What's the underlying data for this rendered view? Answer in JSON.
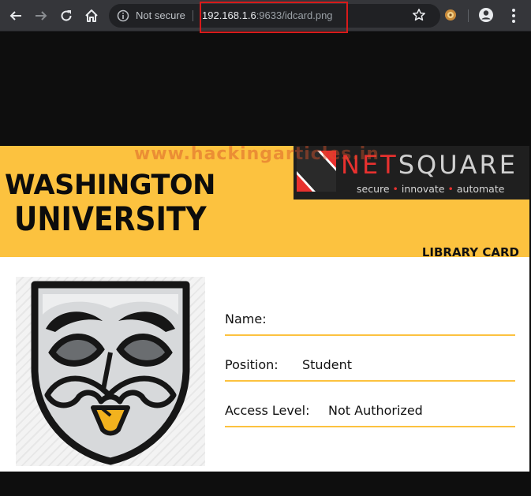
{
  "browser": {
    "security_label": "Not secure",
    "url_host": "192.168.1.6",
    "url_rest": ":9633/idcard.png",
    "icons": [
      "back-arrow-icon",
      "forward-arrow-icon",
      "reload-icon",
      "home-icon",
      "info-icon",
      "star-icon",
      "extension-icon",
      "account-icon",
      "menu-dots-icon"
    ],
    "highlight_color": "#d81a1a"
  },
  "card": {
    "university_line1": "WASHINGTON",
    "university_line2": "UNIVERSITY",
    "logo": {
      "net": "NET",
      "square": "SQUARE",
      "tag_1": "secure",
      "tag_2": "innovate",
      "tag_3": "automate",
      "tag_dot": "•"
    },
    "watermark": "www.hackingarticles.in",
    "card_type": "LIBRARY CARD",
    "avatar": "anonymous-mask-icon",
    "fields": {
      "name_label": "Name:",
      "name_value": "",
      "position_label": "Position:",
      "position_value": "Student",
      "access_label": "Access Level:",
      "access_value": "Not Authorized"
    },
    "colors": {
      "banner": "#fcc23f",
      "logo_bg": "#1f1f1f",
      "logo_red": "#e8312f"
    }
  }
}
